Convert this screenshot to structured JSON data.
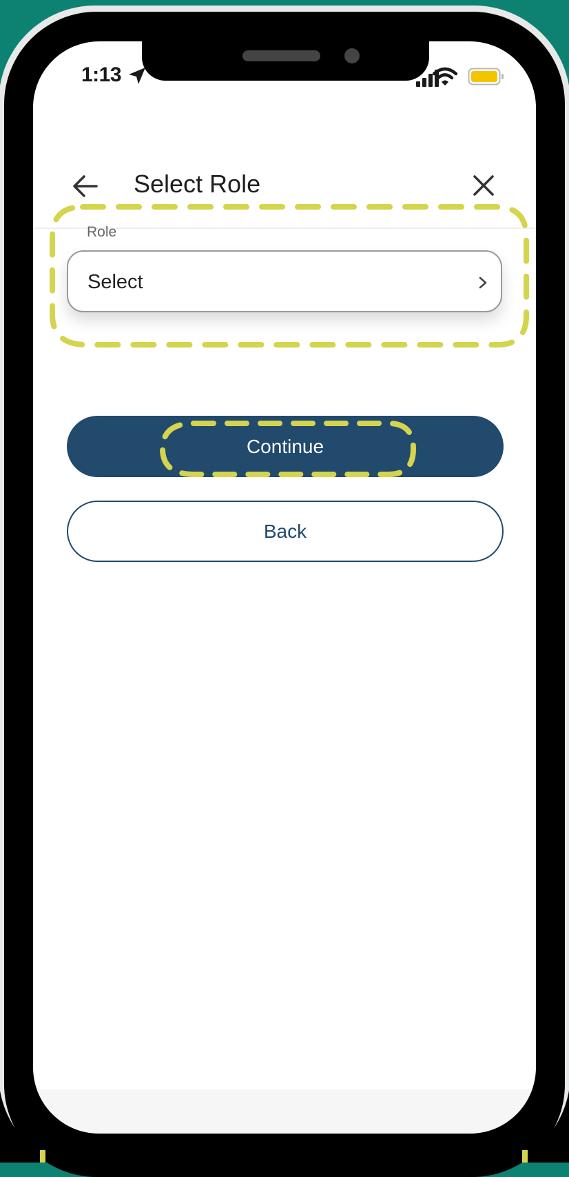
{
  "status_bar": {
    "time": "1:13",
    "location_icon": "location-arrow-icon",
    "signal_icon": "cellular-signal-icon",
    "wifi_icon": "wifi-icon",
    "battery_icon": "battery-icon",
    "battery_color": "#f5c400"
  },
  "header": {
    "title": "Select Role",
    "back_icon": "back-arrow-icon",
    "close_icon": "close-icon"
  },
  "role_field": {
    "label": "Role",
    "value": "Select",
    "chevron_icon": "chevron-right-icon"
  },
  "actions": {
    "continue_label": "Continue",
    "back_label": "Back"
  },
  "colors": {
    "background": "#0d8273",
    "primary": "#214a6d",
    "highlight_annotation": "#d4d44e"
  }
}
